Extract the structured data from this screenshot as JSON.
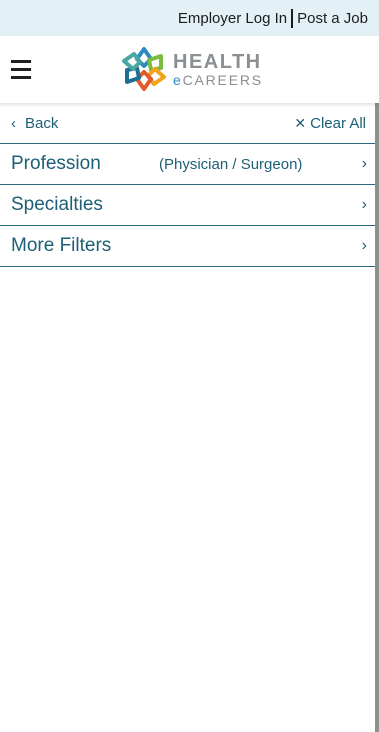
{
  "topbar": {
    "employer_login": "Employer Log In",
    "post_job": "Post a Job"
  },
  "header": {
    "logo_line1": "HEALTH",
    "logo_e": "e",
    "logo_line2": "CAREERS"
  },
  "filters_nav": {
    "back_label": "Back",
    "clear_label": "Clear All"
  },
  "filters": [
    {
      "label": "Profession",
      "value": "(Physician / Surgeon)"
    },
    {
      "label": "Specialties",
      "value": ""
    },
    {
      "label": "More Filters",
      "value": ""
    }
  ],
  "icons": {
    "menu": "hamburger-icon",
    "back": "chevron-left-icon",
    "clear": "close-icon",
    "row": "chevron-right-icon"
  },
  "colors": {
    "topbar_bg": "#e3f1f6",
    "accent": "#1d5f75",
    "logo_gray": "#8a8f93",
    "logo_blue": "#2a8bc0"
  }
}
